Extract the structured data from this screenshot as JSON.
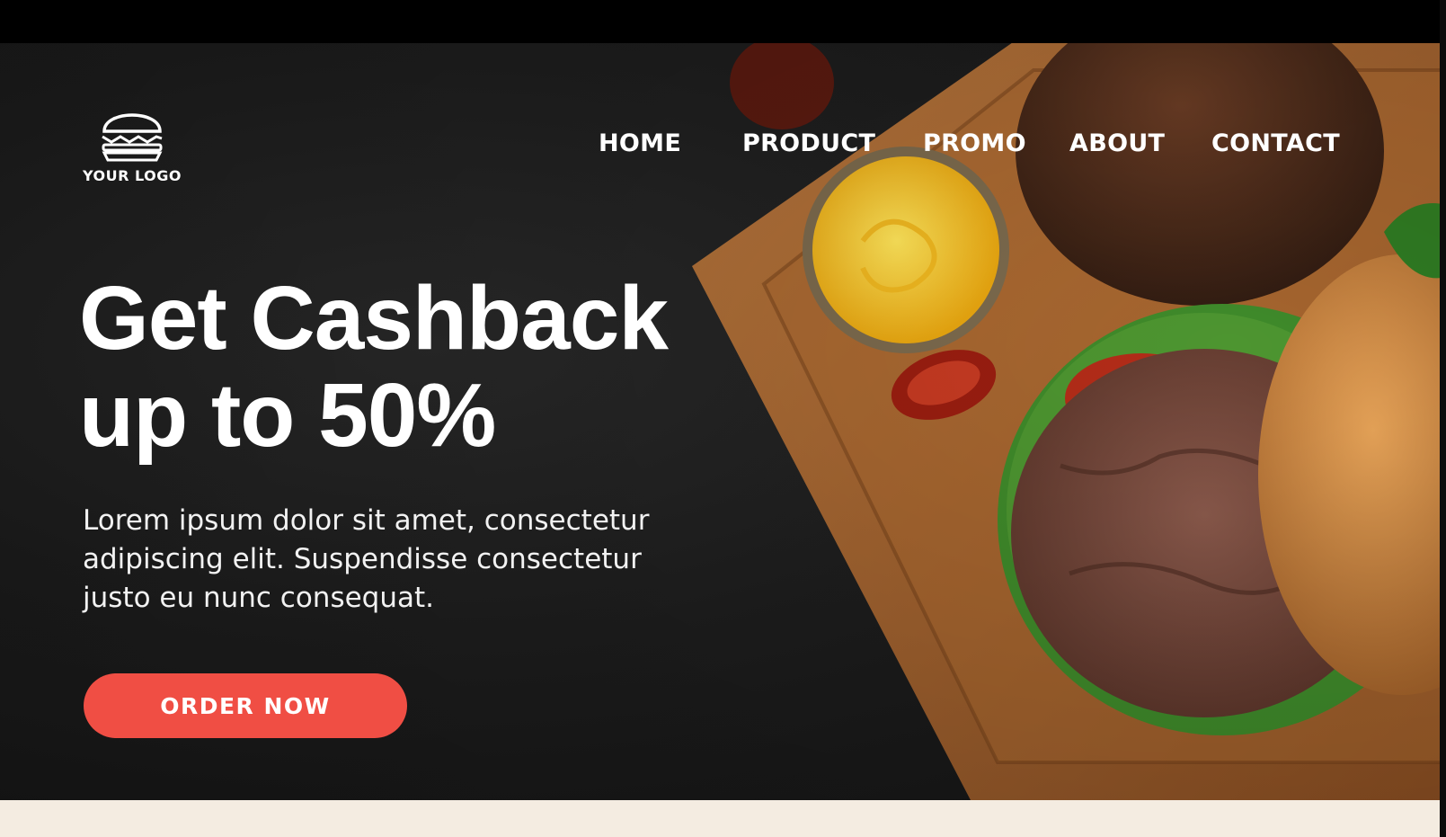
{
  "logo": {
    "text": "YOUR LOGO",
    "icon": "burger-icon"
  },
  "nav": {
    "items": [
      {
        "label": "HOME"
      },
      {
        "label": "PRODUCT"
      },
      {
        "label": "PROMO"
      },
      {
        "label": "ABOUT"
      },
      {
        "label": "CONTACT"
      }
    ]
  },
  "hero": {
    "headline_line1": "Get Cashback",
    "headline_line2": "up to 50%",
    "description": "Lorem ipsum dolor sit amet, consectetur adipiscing elit. Suspendisse consectetur justo eu nunc consequat.",
    "cta_label": "ORDER NOW"
  },
  "colors": {
    "background": "#1e1e1e",
    "accent": "#f04e44",
    "text": "#ffffff",
    "footer_strip": "#f4ece1"
  }
}
